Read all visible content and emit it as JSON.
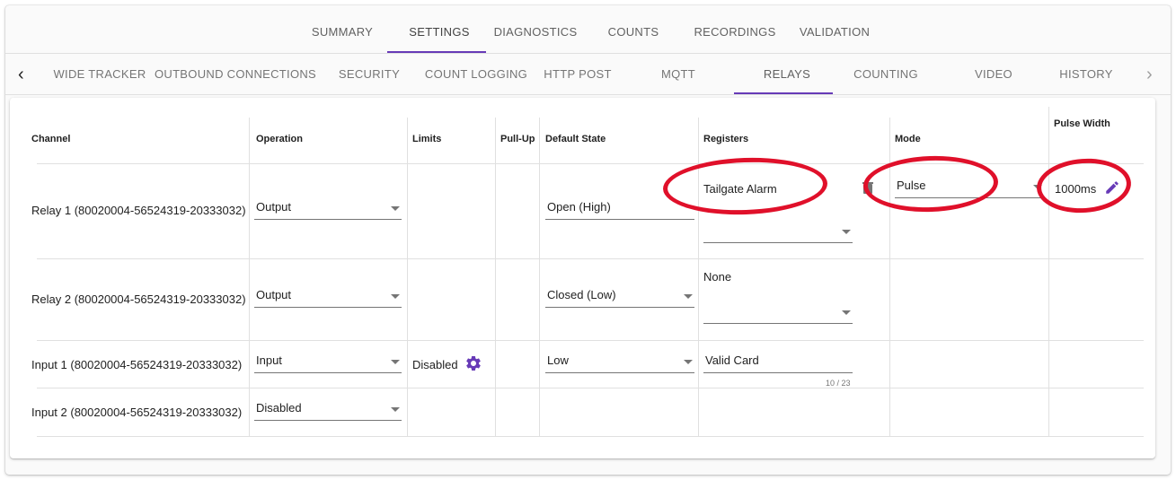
{
  "top_tabs": [
    "SUMMARY",
    "SETTINGS",
    "DIAGNOSTICS",
    "COUNTS",
    "RECORDINGS",
    "VALIDATION"
  ],
  "sub_tabs": [
    "WIDE TRACKER",
    "OUTBOUND CONNECTIONS",
    "SECURITY",
    "COUNT LOGGING",
    "HTTP POST",
    "MQTT",
    "RELAYS",
    "COUNTING",
    "VIDEO",
    "HISTORY"
  ],
  "nav": {
    "prev_arrow": "‹",
    "next_arrow": "›"
  },
  "table": {
    "headers": {
      "channel": "Channel",
      "operation": "Operation",
      "limits": "Limits",
      "pullup": "Pull-Up",
      "default_state": "Default State",
      "registers": "Registers",
      "mode": "Mode",
      "pulse_width": "Pulse Width"
    },
    "rows": [
      {
        "channel": "Relay 1 (80020004-56524319-20333032)",
        "operation": "Output",
        "default_state": "Open (High)",
        "register_label": "Tailgate Alarm",
        "mode": "Pulse",
        "pulse_width": "1000ms"
      },
      {
        "channel": "Relay 2 (80020004-56524319-20333032)",
        "operation": "Output",
        "default_state": "Closed (Low)",
        "register_label": "None"
      },
      {
        "channel": "Input 1 (80020004-56524319-20333032)",
        "operation": "Input",
        "limits": "Disabled",
        "default_state": "Low",
        "register_value": "Valid Card",
        "register_counter": "10 / 23"
      },
      {
        "channel": "Input 2 (80020004-56524319-20333032)",
        "operation": "Disabled"
      }
    ]
  },
  "colors": {
    "accent": "#673ab7",
    "annotation": "#e0102a"
  },
  "icons": {
    "gear": "gear-icon",
    "pencil": "pencil-icon",
    "trash": "trash-icon"
  }
}
